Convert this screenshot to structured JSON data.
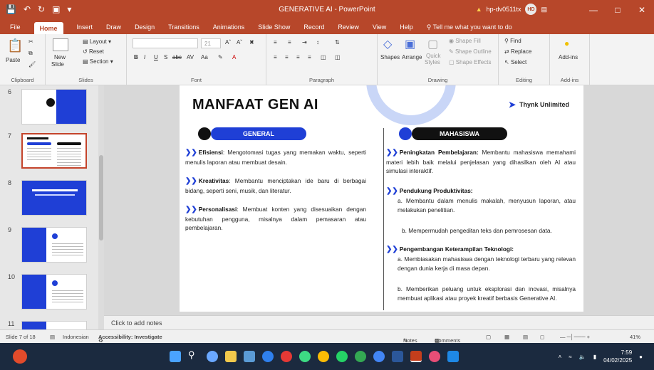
{
  "window": {
    "title": "GENERATIVE AI - PowerPoint",
    "warning_icon": "warning-icon",
    "user": "hp-dv0511tx",
    "user_initials": "HD"
  },
  "tabs": [
    "File",
    "Home",
    "Insert",
    "Draw",
    "Design",
    "Transitions",
    "Animations",
    "Slide Show",
    "Record",
    "Review",
    "View",
    "Help"
  ],
  "active_tab": "Home",
  "tell_me": "Tell me what you want to do",
  "ribbon": {
    "clipboard": {
      "paste": "Paste",
      "label": "Clipboard"
    },
    "slides": {
      "new_slide": "New",
      "new_slide2": "Slide",
      "layout": "Layout",
      "reset": "Reset",
      "section": "Section",
      "label": "Slides"
    },
    "font": {
      "size": "21",
      "label": "Font",
      "buttons": [
        "B",
        "I",
        "U",
        "S",
        "abc",
        "AV",
        "Aa",
        "A"
      ]
    },
    "paragraph": {
      "label": "Paragraph"
    },
    "drawing": {
      "shapes": "Shapes",
      "arrange": "Arrange",
      "quick_styles": "Quick",
      "quick_styles2": "Styles",
      "shape_fill": "Shape Fill",
      "shape_outline": "Shape Outline",
      "shape_effects": "Shape Effects",
      "label": "Drawing"
    },
    "editing": {
      "find": "Find",
      "replace": "Replace",
      "select": "Select",
      "label": "Editing"
    },
    "addins": {
      "button": "Add-ins",
      "label": "Add-ins"
    }
  },
  "thumbnails": [
    {
      "num": "6"
    },
    {
      "num": "7"
    },
    {
      "num": "8"
    },
    {
      "num": "9"
    },
    {
      "num": "10"
    },
    {
      "num": "11"
    }
  ],
  "slide": {
    "title": "MANFAAT GEN AI",
    "brand": "Thynk Unlimited",
    "left_header": "GENERAL",
    "right_header": "MAHASISWA",
    "left_items": [
      {
        "term": "Efisiensi",
        "text": ": Mengotomasi tugas yang memakan waktu, seperti menulis laporan atau membuat desain."
      },
      {
        "term": "Kreativitas",
        "text": ": Membantu menciptakan ide baru di berbagai bidang, seperti seni, musik, dan literatur."
      },
      {
        "term": "Personalisasi",
        "text": ": Membuat konten yang disesuaikan dengan kebutuhan pengguna, misalnya dalam pemasaran atau pembelajaran."
      }
    ],
    "right_items": [
      {
        "term": "Peningkatan Pembelajaran:",
        "text": " Membantu mahasiswa memahami materi lebih baik melalui penjelasan yang dihasilkan oleh AI atau simulasi interaktif."
      },
      {
        "term": "Pendukung Produktivitas:",
        "text": ""
      },
      {
        "term": "",
        "text": "a. Membantu dalam menulis makalah, menyusun laporan, atau melakukan penelitian."
      },
      {
        "term": "",
        "text": "b. Mempermudah pengeditan teks dan pemrosesan data."
      },
      {
        "term": "Pengembangan Keterampilan Teknologi:",
        "text": ""
      },
      {
        "term": "",
        "text": "a. Membiasakan mahasiswa dengan teknologi terbaru yang relevan dengan dunia kerja di masa depan."
      },
      {
        "term": "",
        "text": "b. Memberikan peluang untuk eksplorasi dan inovasi, misalnya membuat aplikasi atau proyek kreatif berbasis Generative AI."
      }
    ]
  },
  "notes_placeholder": "Click to add notes",
  "status": {
    "slide_of": "Slide 7 of 18",
    "language": "Indonesian",
    "accessibility": "Accessibility: Investigate",
    "notes": "Notes",
    "comments": "Comments",
    "zoom": "41%"
  },
  "tray": {
    "time": "7:59",
    "date": "04/02/2025"
  },
  "colors": {
    "accent": "#b7472a",
    "slide_blue": "#1f3fd6",
    "dark": "#111111"
  }
}
